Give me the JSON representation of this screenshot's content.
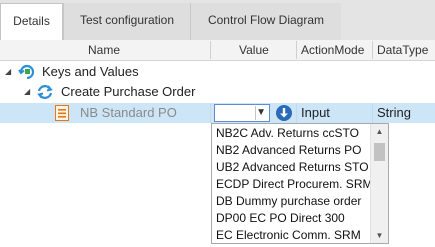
{
  "tabs": [
    {
      "label": "Details"
    },
    {
      "label": "Test configuration"
    },
    {
      "label": "Control Flow Diagram"
    }
  ],
  "columns": {
    "name": "Name",
    "value": "Value",
    "action_mode": "ActionMode",
    "data_type": "DataType"
  },
  "tree": {
    "root_label": "Keys and Values",
    "child_label": "Create Purchase Order",
    "leaf": {
      "name": "NB Standard PO",
      "action_mode": "Input",
      "data_type": "String"
    }
  },
  "dropdown": {
    "options": [
      "NB2C Adv. Returns ccSTO",
      "NB2 Advanced Returns PO",
      "UB2 Advanced Returns STO",
      "ECDP Direct Procurem. SRM",
      "DB Dummy purchase order",
      "DP00 EC PO Direct 300",
      "EC Electronic Comm. SRM"
    ]
  },
  "colors": {
    "selection": "#cde6f7",
    "accent": "#2a6ab8",
    "refresh_icon": "#2f8fd6",
    "orange_icon": "#e07a1e"
  },
  "icons": {
    "root": "keys-values-icon",
    "child": "refresh-cycle-icon",
    "leaf": "list-item-icon",
    "value_button": "download-arrow-icon"
  }
}
